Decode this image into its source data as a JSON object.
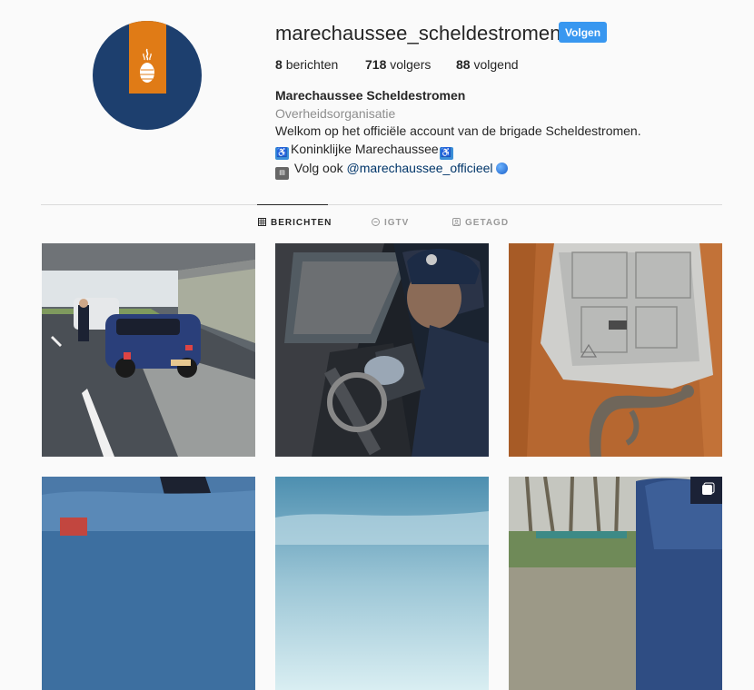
{
  "profile": {
    "username": "marechaussee_scheldestromen",
    "follow_label": "Volgen",
    "stats": {
      "posts_count": "8",
      "posts_label": "berichten",
      "followers_count": "718",
      "followers_label": "volgers",
      "following_count": "88",
      "following_label": "volgend"
    },
    "bio": {
      "name": "Marechaussee Scheldestromen",
      "category": "Overheidsorganisatie",
      "line1": "Welkom op het officiële account van de brigade Scheldestromen.",
      "line2": "Koninklijke Marechaussee",
      "line3_prefix": "Volg ook ",
      "line3_link": "@marechaussee_officieel"
    }
  },
  "tabs": [
    {
      "label": "BERICHTEN",
      "icon": "grid-icon",
      "active": true
    },
    {
      "label": "IGTV",
      "icon": "igtv-icon",
      "active": false
    },
    {
      "label": "GETAGD",
      "icon": "tag-icon",
      "active": false
    }
  ],
  "posts": [
    {
      "subject": "traffic-stop-under-overpass"
    },
    {
      "subject": "officer-searching-car"
    },
    {
      "subject": "evidence-bag-with-hook"
    },
    {
      "subject": "uniform-shoulder-closeup"
    },
    {
      "subject": "sky-over-water"
    },
    {
      "subject": "officer-on-bicycle"
    }
  ],
  "colors": {
    "accent": "#3897f0",
    "avatar_blue": "#1d3f6e",
    "avatar_orange": "#e07b16",
    "link": "#003569"
  }
}
